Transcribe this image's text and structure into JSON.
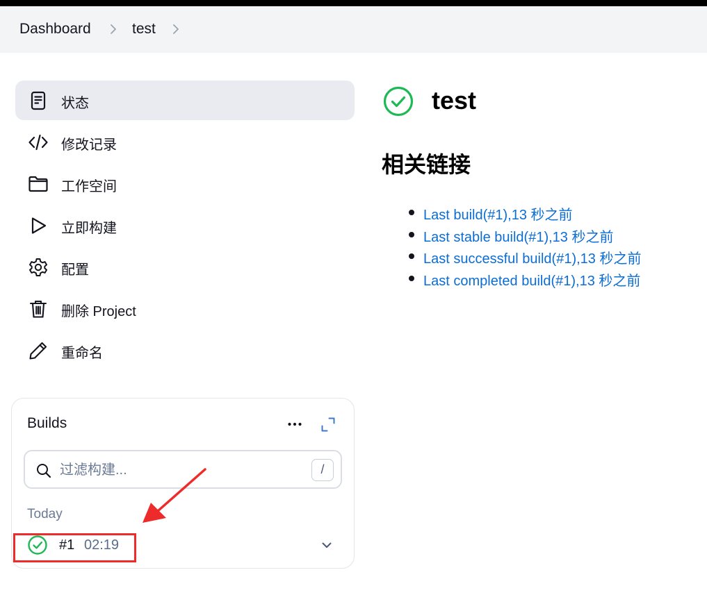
{
  "breadcrumb": {
    "items": [
      "Dashboard",
      "test"
    ]
  },
  "sidebar": {
    "items": [
      {
        "label": "状态",
        "icon": "document-icon",
        "active": true
      },
      {
        "label": "修改记录",
        "icon": "code-icon",
        "active": false
      },
      {
        "label": "工作空间",
        "icon": "folder-icon",
        "active": false
      },
      {
        "label": "立即构建",
        "icon": "play-icon",
        "active": false
      },
      {
        "label": "配置",
        "icon": "gear-icon",
        "active": false
      },
      {
        "label": "删除 Project",
        "icon": "trash-icon",
        "active": false
      },
      {
        "label": "重命名",
        "icon": "pencil-icon",
        "active": false
      }
    ]
  },
  "builds": {
    "title": "Builds",
    "filter_placeholder": "过滤构建...",
    "shortcut_key": "/",
    "group_label": "Today",
    "rows": [
      {
        "number": "#1",
        "time": "02:19",
        "status": "success"
      }
    ]
  },
  "project": {
    "title": "test",
    "status": "success",
    "links_heading": "相关链接",
    "links": [
      "Last build(#1),13 秒之前",
      "Last stable build(#1),13 秒之前",
      "Last successful build(#1),13 秒之前",
      "Last completed build(#1),13 秒之前"
    ]
  },
  "colors": {
    "success": "#1db954",
    "link": "#0b6dd4",
    "annotation": "#ee2b2b",
    "active_bg": "#e9ebf0"
  }
}
